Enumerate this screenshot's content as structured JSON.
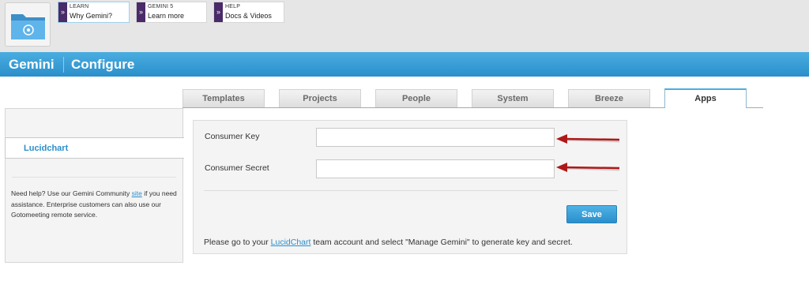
{
  "promos": [
    {
      "small": "LEARN",
      "big": "Why Gemini?",
      "marker": "»"
    },
    {
      "small": "GEMINI 5",
      "big": "Learn more",
      "marker": "»"
    },
    {
      "small": "HELP",
      "big": "Docs & Videos",
      "marker": "»"
    }
  ],
  "header": {
    "brand": "Gemini",
    "page": "Configure"
  },
  "tabs": [
    "Templates",
    "Projects",
    "People",
    "System",
    "Breeze",
    "Apps"
  ],
  "active_tab": "Apps",
  "sidebar": {
    "item": "Lucidchart",
    "help_before": "Need help? Use our Gemini Community ",
    "help_link": "site",
    "help_after": " if you need assistance. Enterprise customers can also use our Gotomeeting remote service."
  },
  "form": {
    "consumer_key_label": "Consumer Key",
    "consumer_key_value": "",
    "consumer_secret_label": "Consumer Secret",
    "consumer_secret_value": "",
    "save_label": "Save",
    "note_before": "Please go to your ",
    "note_link": "LucidChart",
    "note_after": " team account and select \"Manage Gemini\" to generate key and secret."
  },
  "colors": {
    "accent": "#2b8fcb",
    "promo_marker": "#4a2a68",
    "arrow": "#b01818"
  }
}
